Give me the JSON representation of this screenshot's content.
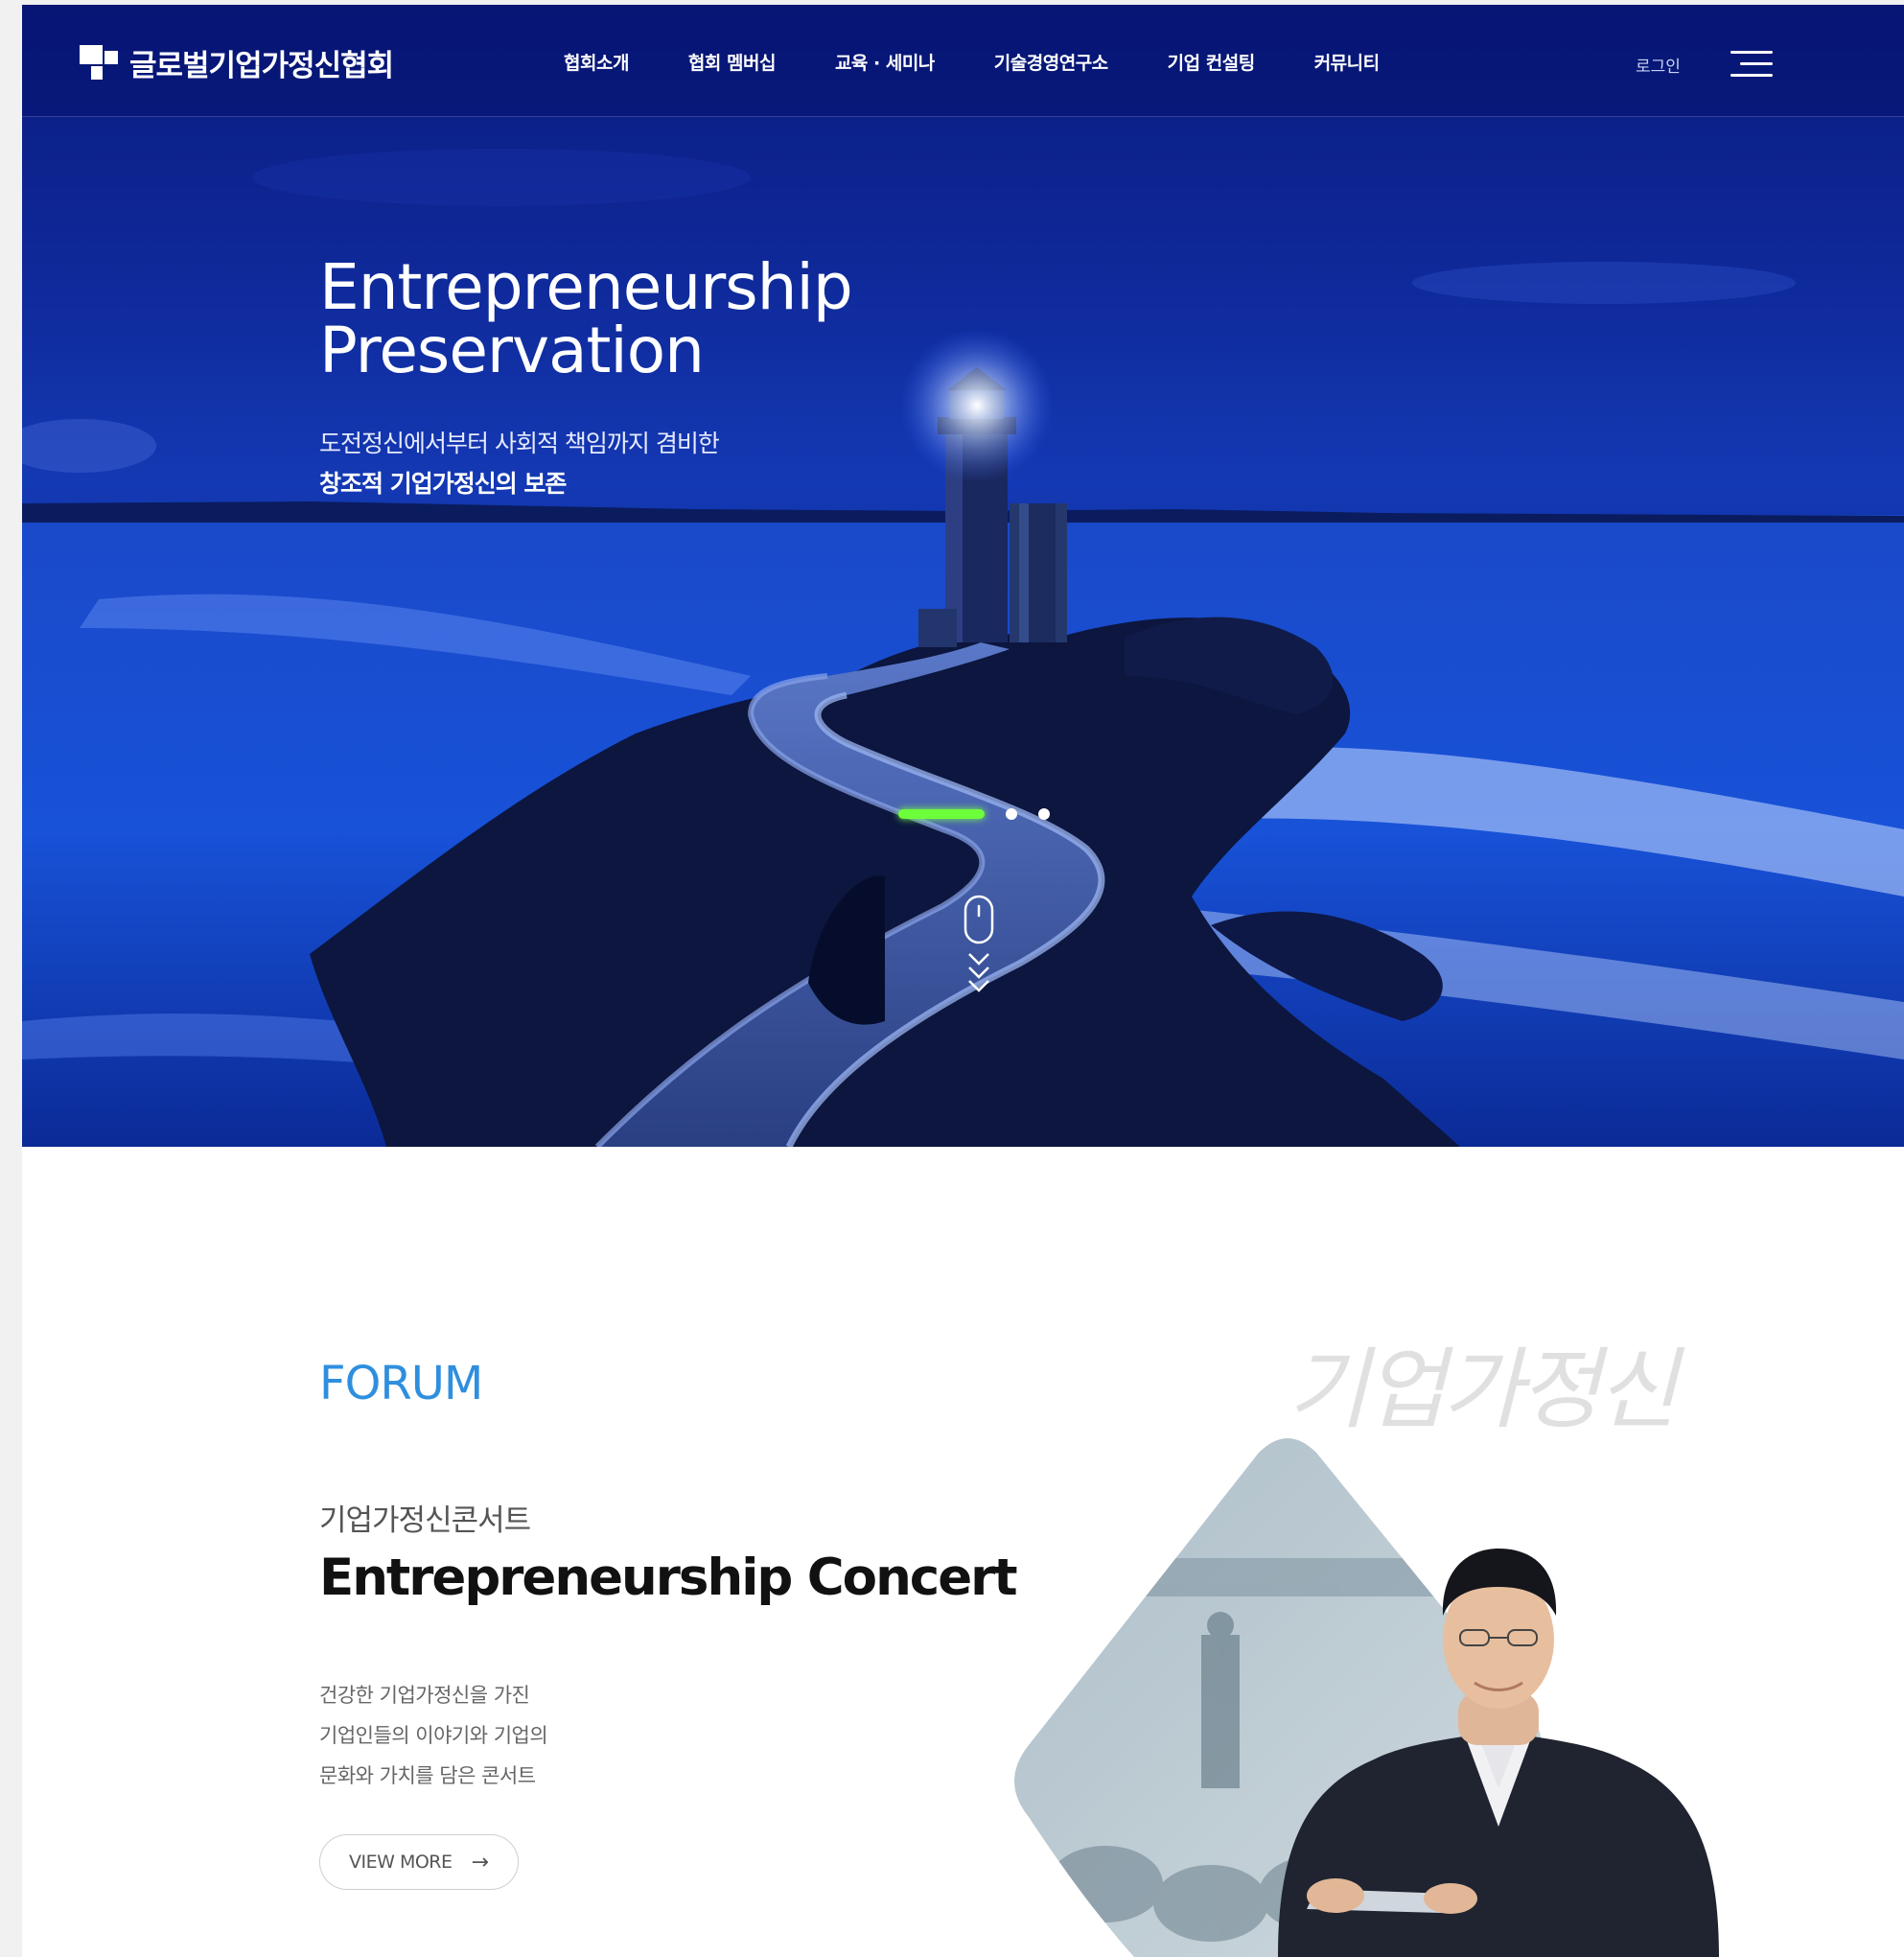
{
  "header": {
    "logo_text": "글로벌기업가정신협회",
    "nav": [
      "협회소개",
      "협회 멤버십",
      "교육 · 세미나",
      "기술경영연구소",
      "기업 컨설팅",
      "커뮤니티"
    ],
    "login_label": "로그인",
    "menu_icon": "hamburger-menu-icon"
  },
  "hero": {
    "title_line1": "Entrepreneurship",
    "title_line2": "Preservation",
    "subtitle_line1": "도전정신에서부터 사회적 책임까지 겸비한",
    "subtitle_line2": "창조적 기업가정신의 보존",
    "slides_total": 3,
    "active_slide": 1,
    "accent_color": "#6cff3a",
    "scroll_icon": "mouse-scroll-icon"
  },
  "forum": {
    "section_label": "FORUM",
    "korean_title": "기업가정신콘서트",
    "title": "Entrepreneurship Concert",
    "description": [
      "건강한 기업가정신을 가진",
      "기업인들의 이야기와 기업의",
      "문화와 가치를 담은 콘서트"
    ],
    "button_label": "VIEW MORE",
    "button_icon": "arrow-right-icon",
    "calligraphy_text": "기업가정신",
    "accent_color": "#2f8fde"
  }
}
